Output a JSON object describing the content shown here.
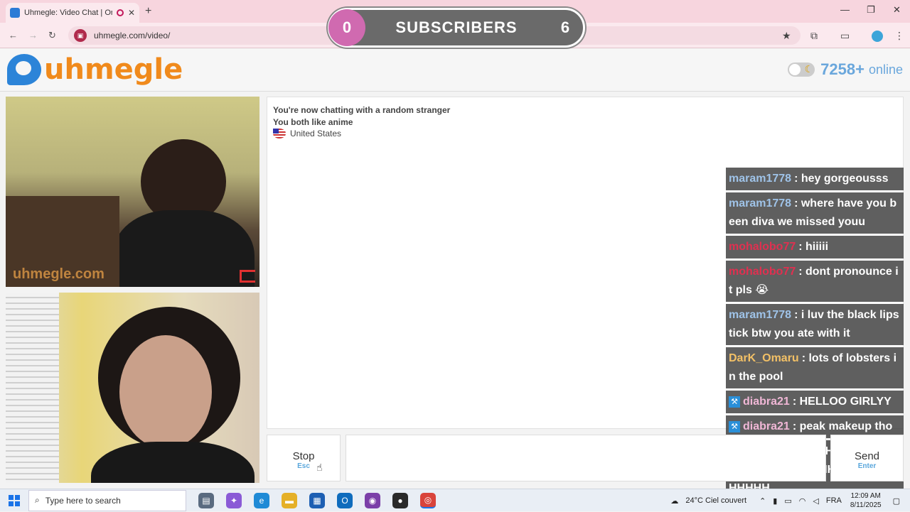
{
  "browser": {
    "tab_title": "Uhmegle: Video Chat | Ome",
    "url": "uhmegle.com/video/",
    "new_tab_glyph": "+",
    "close_glyph": "✕",
    "minimize_glyph": "—",
    "restore_glyph": "❐",
    "window_close_glyph": "✕"
  },
  "subscriber_overlay": {
    "left_count": "0",
    "label": "SUBSCRIBERS",
    "right_count": "6"
  },
  "header": {
    "logo_text": "uhmegle",
    "online_count": "7258+",
    "online_label": "online"
  },
  "video": {
    "watermark": "uhmegle.com"
  },
  "chat": {
    "system_lines": [
      "You're now chatting with a random stranger",
      "You both like anime",
      "United States"
    ],
    "overlay_messages": [
      {
        "user": "maram1778",
        "text": ": hey gorgeousss",
        "color": "#9fc3e8",
        "badge": false
      },
      {
        "user": "maram1778",
        "text": ": where have you been diva we missed youu",
        "color": "#9fc3e8",
        "badge": false
      },
      {
        "user": "mohalobo77",
        "text": ": hiiiii",
        "color": "#e03050",
        "badge": false
      },
      {
        "user": "mohalobo77",
        "text": ": dont pronounce it pls 😭",
        "color": "#e03050",
        "badge": false
      },
      {
        "user": "maram1778",
        "text": ": i luv the black lipstick btw you ate with it",
        "color": "#9fc3e8",
        "badge": false
      },
      {
        "user": "DarK_Omaru",
        "text": ": lots of lobsters in the pool",
        "color": "#f2c066",
        "badge": false
      },
      {
        "user": "diabra21",
        "text": ": HELLOO GIRLYY",
        "color": "#f0b7d6",
        "badge": true
      },
      {
        "user": "diabra21",
        "text": ": peak makeup tho",
        "color": "#f0b7d6",
        "badge": true
      },
      {
        "user": "DarK_Omaru",
        "text": ": HHHHHHHHHHHHHHHHHHHHHHHHHHHHHHHHHHHH",
        "color": "#f2c066",
        "badge": false
      }
    ]
  },
  "controls": {
    "stop_label": "Stop",
    "stop_key": "Esc",
    "send_label": "Send",
    "send_key": "Enter"
  },
  "taskbar": {
    "search_placeholder": "Type here to search",
    "weather": "24°C  Ciel couvert",
    "language": "FRA",
    "time": "12:09 AM",
    "date": "8/11/2025"
  }
}
